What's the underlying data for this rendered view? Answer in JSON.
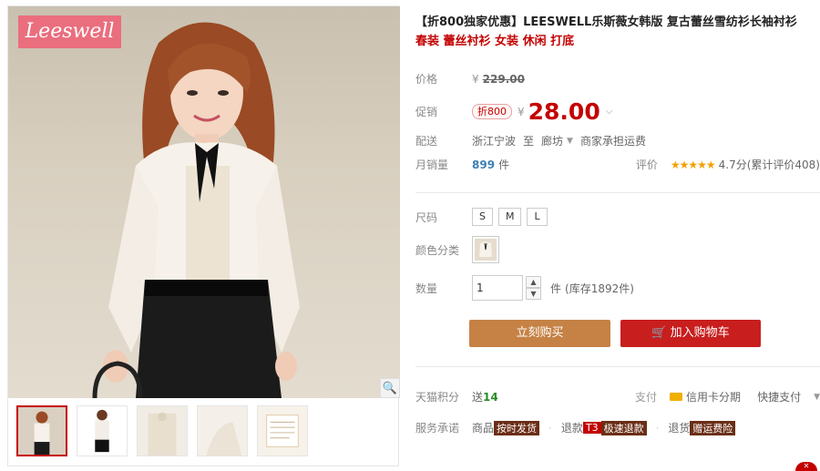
{
  "brand_logo": "Leeswell",
  "product": {
    "title": "【折800独家优惠】LEESWELL乐斯薇女韩版 复古蕾丝雪纺衫长袖衬衫",
    "subtitle": "春装 蕾丝衬衫 女装 休闲 打底"
  },
  "price": {
    "label": "价格",
    "currency": "¥",
    "original": "229.00"
  },
  "promo": {
    "label": "促销",
    "badge": "折800",
    "currency": "¥",
    "price": "28.00"
  },
  "shipping": {
    "label": "配送",
    "from": "浙江宁波",
    "to_word": "至",
    "to": "廊坊",
    "fee": "商家承担运费"
  },
  "sales": {
    "label": "月销量",
    "count": "899",
    "unit": "件"
  },
  "rating": {
    "label": "评价",
    "stars": "★★★★★",
    "score": "4.7分",
    "count_text": "(累计评价408)"
  },
  "size": {
    "label": "尺码",
    "options": [
      "S",
      "M",
      "L"
    ]
  },
  "color": {
    "label": "颜色分类"
  },
  "quantity": {
    "label": "数量",
    "value": "1",
    "unit": "件",
    "stock": "(库存1892件)"
  },
  "buttons": {
    "buy": "立刻购买",
    "cart": "加入购物车"
  },
  "tmall_points": {
    "label": "天猫积分",
    "prefix": "送",
    "value": "14"
  },
  "payment": {
    "label": "支付",
    "credit": "信用卡分期",
    "quick": "快捷支付"
  },
  "service": {
    "label": "服务承诺",
    "goods_prefix": "商品",
    "goods_tag": "按时发货",
    "refund_prefix": "退款",
    "refund_badge": "T3",
    "refund_tag": "极速退款",
    "return_prefix": "退货",
    "return_tag": "赠运费险"
  },
  "colors": {
    "accent_red": "#c40000",
    "buy_button": "#c68245",
    "cart_button": "#c81e1e",
    "logo_bg": "#ea6e7e"
  }
}
